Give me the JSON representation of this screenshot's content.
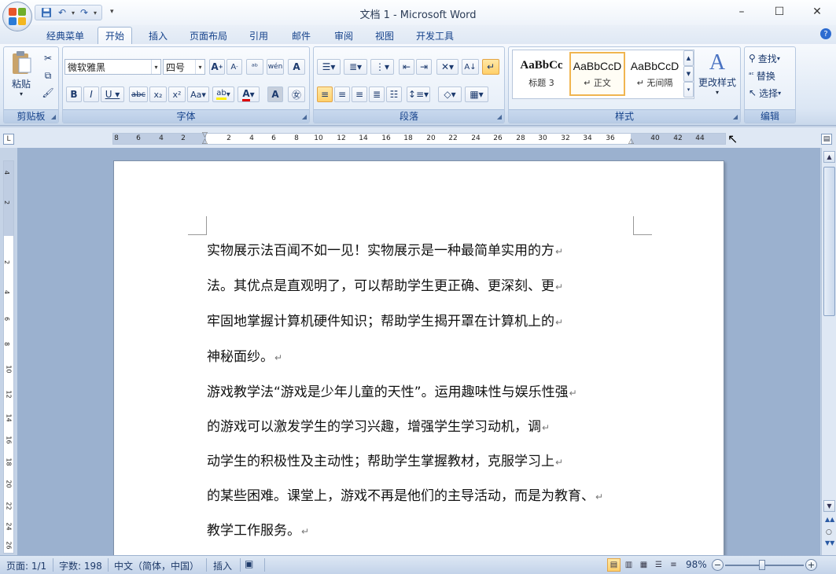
{
  "window": {
    "title": "文档 1 - Microsoft Word"
  },
  "tabs": [
    "经典菜单",
    "开始",
    "插入",
    "页面布局",
    "引用",
    "邮件",
    "审阅",
    "视图",
    "开发工具"
  ],
  "ribbon": {
    "clipboard": {
      "label": "剪贴板",
      "paste": "粘贴"
    },
    "font": {
      "label": "字体",
      "font_name": "微软雅黑",
      "font_size": "四号"
    },
    "paragraph": {
      "label": "段落"
    },
    "styles": {
      "label": "样式",
      "items": [
        {
          "sample": "AaBbCc",
          "name": "标题 3"
        },
        {
          "sample": "AaBbCcD",
          "name": "↵ 正文"
        },
        {
          "sample": "AaBbCcD",
          "name": "↵ 无间隔"
        }
      ],
      "change_styles": "更改样式"
    },
    "editing": {
      "label": "编辑",
      "find": "查找",
      "replace": "替换",
      "select": "选择"
    }
  },
  "ruler": {
    "h_numbers": [
      "8",
      "6",
      "4",
      "2",
      "2",
      "4",
      "6",
      "8",
      "10",
      "12",
      "14",
      "16",
      "18",
      "20",
      "22",
      "24",
      "26",
      "28",
      "30",
      "32",
      "34",
      "36",
      "40",
      "42",
      "44"
    ],
    "v_numbers": [
      "4",
      "2",
      "2",
      "4",
      "6",
      "8",
      "10",
      "12",
      "14",
      "16",
      "18",
      "20",
      "22",
      "24",
      "26"
    ]
  },
  "document": {
    "lines": [
      "实物展示法百闻不如一见！实物展示是一种最简单实用的方",
      "法。其优点是直观明了，可以帮助学生更正确、更深刻、更",
      "牢固地掌握计算机硬件知识；帮助学生揭开罩在计算机上的",
      "神秘面纱。",
      "游戏教学法“游戏是少年儿童的天性”。运用趣味性与娱乐性强",
      "的游戏可以激发学生的学习兴趣，增强学生学习动机，调",
      "动学生的积极性及主动性；帮助学生掌握教材，克服学习上",
      "的某些困难。课堂上，游戏不再是他们的主导活动，而是为教育、",
      "教学工作服务。"
    ],
    "para_mark": "↵"
  },
  "status": {
    "page": "页面: 1/1",
    "words": "字数: 198",
    "language": "中文（简体，中国）",
    "mode": "插入",
    "zoom": "98%"
  },
  "colors": {
    "accent": "#15428b",
    "ribbon_bg": "#dbe6f4",
    "active_highlight": "#ffd06a"
  }
}
